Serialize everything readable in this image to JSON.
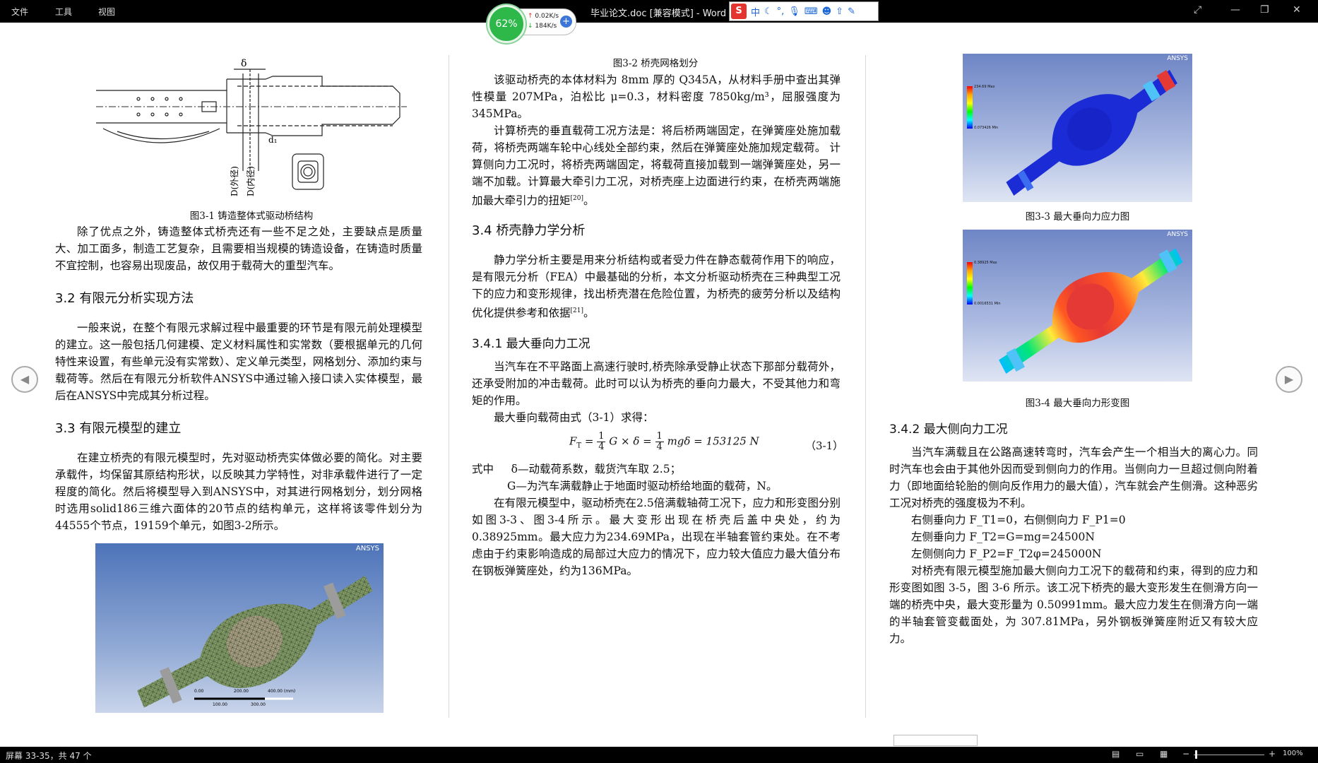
{
  "titlebar": {
    "menu": [
      "文件",
      "工具",
      "视图"
    ],
    "title": "毕业论文.doc [兼容模式] - Word",
    "window_controls": [
      "restore-icon",
      "minimize-icon",
      "maximize-icon",
      "close-icon"
    ]
  },
  "speed_widget": {
    "percent": "62%",
    "up": "0.02K/s",
    "down": "184K/s",
    "plus": "+"
  },
  "ime_toolbar": {
    "logo": "S",
    "mode": "中",
    "icons": [
      "moon-icon",
      "punctuation-icon",
      "microphone-icon",
      "keyboard-icon",
      "skin-icon",
      "upload-icon",
      "wrench-icon"
    ]
  },
  "col1": {
    "fig1_caption": "图3-1   铸造整体式驱动桥结构",
    "fig1_labels": {
      "delta": "δ",
      "d1": "d₁",
      "outer": "D(外径)",
      "inner": "D(内径)"
    },
    "para1": "除了优点之外，铸造整体式桥壳还有一些不足之处，主要缺点是质量大、加工面多，制造工艺复杂，且需要相当规模的铸造设备，在铸造时质量不宜控制，也容易出现废品，故仅用于载荷大的重型汽车。",
    "h32": "3.2    有限元分析实现方法",
    "para2": "一般来说，在整个有限元求解过程中最重要的环节是有限元前处理模型的建立。这一般包括几何建模、定义材料属性和实常数（要根据单元的几何特性来设置，有些单元没有实常数）、定义单元类型，网格划分、添加约束与载荷等。然后在有限元分析软件ANSYS中通过输入接口读入实体模型，最后在ANSYS中完成其分析过程。",
    "h33": "3.3    有限元模型的建立",
    "para3": "在建立桥壳的有限元模型时，先对驱动桥壳实体做必要的简化。对主要承载件，均保留其原结构形状，以反映其力学特性，对非承载件进行了一定程度的简化。然后将模型导入到ANSYS中，对其进行网格划分，划分网格时选用solid186三维六面体的20节点的结构单元，这样将该零件划分为44555个节点，19159个单元，如图3-2所示。",
    "mesh_logo": "ANSYS",
    "mesh_scale": [
      "0.00",
      "200.00",
      "400.00 (mm)",
      "100.00",
      "300.00"
    ]
  },
  "col2": {
    "fig2_caption": "图3-2  桥壳网格划分",
    "para1": "该驱动桥壳的本体材料为 8mm 厚的 Q345A，从材料手册中查出其弹性模量 207MPa，泊松比 μ=0.3，材料密度 7850kg/m³，屈服强度为345MPa。",
    "para2": "计算桥壳的垂直载荷工况方法是：将后桥两端固定，在弹簧座处施加载荷，将桥壳两端车轮中心线处全部约束，然后在弹簧座处施加规定载荷。 计算侧向力工况时，将桥壳两端固定，将载荷直接加载到一端弹簧座处，另一端不加载。计算最大牵引力工况，对桥壳座上边面进行约束，在桥壳两端施加最大牵引力的扭矩",
    "para2_ref": "[20]",
    "para2_end": "。",
    "h34": "3.4    桥壳静力学分析",
    "para3": "静力学分析主要是用来分析结构或者受力件在静态载荷作用下的响应，是有限元分析（FEA）中最基础的分析，本文分析驱动桥壳在三种典型工况下的应力和变形规律，找出桥壳潜在危险位置，为桥壳的疲劳分析以及结构优化提供参考和依据",
    "para3_ref": "[21]",
    "para3_end": "。",
    "h341": "3.4.1    最大垂向力工况",
    "para4": "当汽车在不平路面上高速行驶时,桥壳除承受静止状态下那部分载荷外，还承受附加的冲击载荷。此时可以认为桥壳的垂向力最大，不受其他力和弯矩的作用。",
    "para5": "最大垂向载荷由式（3-1）求得：",
    "formula": {
      "lhs": "F",
      "lhs_sub": "T",
      "eq1": " = ",
      "num1": "1",
      "den1": "4",
      "mid1": "G × δ = ",
      "num2": "1",
      "den2": "4",
      "mid2": "mgδ = 153125 N",
      "number": "（3-1）"
    },
    "where1_label": "式中",
    "where1": "δ—动载荷系数，载货汽车取 2.5；",
    "where2": "G—为汽车满载静止于地面时驱动桥给地面的载荷，N。",
    "para6": "在有限元模型中，驱动桥壳在2.5倍满载轴荷工况下，应力和形变图分别如图3-3、图3-4所示。最大变形出现在桥壳后盖中央处，约为0.38925mm。最大应力为234.69MPa，出现在半轴套管约束处。在不考虑由于约束影响造成的局部过大应力的情况下，应力较大值应力最大值分布在钢板弹簧座处，约为136MPa。"
  },
  "col3": {
    "fig3_caption": "图3-3    最大垂向力应力图",
    "fig4_caption": "图3-4    最大垂向力形变图",
    "fig3_logo": "ANSYS",
    "fig4_logo": "ANSYS",
    "fig3_legend_top": "234.69 Max",
    "fig3_legend_bottom": "0.073426 Min",
    "fig4_legend_top": "0.38925 Max",
    "fig4_legend_bottom": "0.0016531 Min",
    "h342": "3.4.2    最大侧向力工况",
    "para1": "当汽车满载且在公路高速转弯时，汽车会产生一个相当大的离心力。同时汽车也会由于其他外因而受到侧向力的作用。当侧向力一旦超过侧向附着力（即地面给轮胎的侧向反作用力的最大值），汽车就会产生侧滑。这种恶劣工况对桥壳的强度极为不利。",
    "line1": "右侧垂向力 F_T1=0，右侧侧向力 F_P1=0",
    "line2": "左侧垂向力 F_T2=G=mg=24500N",
    "line3": "左侧侧向力 F_P2=F_T2φ=245000N",
    "para2": "对桥壳有限元模型施加最大侧向力工况下的载荷和约束，得到的应力和形变图如图 3-5，图 3-6 所示。该工况下桥壳的最大变形发生在侧滑方向一端的桥壳中央，最大变形量为 0.50991mm。最大应力发生在侧滑方向一端的半轴套管变截面处，为 307.81MPa，另外钢板弹簧座附近又有较大应力。"
  },
  "statusbar": {
    "page_info": "屏幕 33-35，共 47 个",
    "zoom": "100%"
  },
  "nav": {
    "prev": "◀",
    "next": "▶"
  }
}
